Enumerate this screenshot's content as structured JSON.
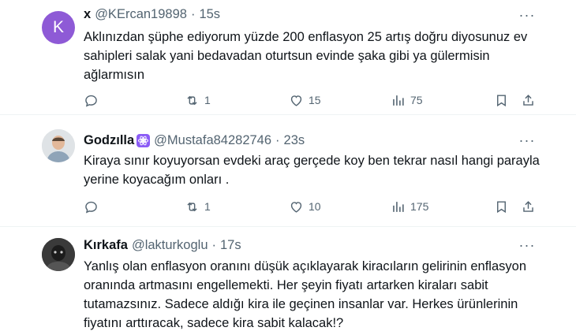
{
  "tweets": [
    {
      "avatar_letter": "K",
      "name": "x",
      "handle": "@KErcan19898",
      "dot": "·",
      "time": "15s",
      "text": "Aklınızdan şüphe ediyorum yüzde 200 enflasyon 25 artış doğru diyosunuz ev sahipleri salak yani bedavadan oturtsun evinde şaka gibi ya gülermisin ağlarmısın",
      "retweets": "1",
      "likes": "15",
      "views": "75",
      "avatar_color": "#8e5ad6"
    },
    {
      "name": "Godzılla",
      "handle": "@Mustafa84282746",
      "dot": "·",
      "time": "23s",
      "text": "Kiraya sınır koyuyorsan evdeki araç gerçede koy ben tekrar nasıl hangi parayla yerine koyacağım onları .",
      "retweets": "1",
      "likes": "10",
      "views": "175",
      "badge_icon": "atom-icon"
    },
    {
      "name": "Kırkafa",
      "handle": "@lakturkoglu",
      "dot": "·",
      "time": "17s",
      "text": "Yanlış olan enflasyon oranını düşük açıklayarak kiracıların gelirinin enflasyon oranında artmasını engellemekti. Her şeyin fiyatı artarken kiraları sabit tutamazsınız. Sadece aldığı kira ile geçinen insanlar var. Herkes ürünlerinin fiyatını arttıracak, sadece kira sabit kalacak!?"
    }
  ],
  "more_label": "···",
  "icons": {
    "reply": "reply-icon",
    "retweet": "retweet-icon",
    "like": "heart-icon",
    "views": "views-icon",
    "bookmark": "bookmark-icon",
    "share": "share-icon"
  },
  "colors": {
    "text": "#0f1419",
    "secondary": "#536471",
    "divider": "#eff3f4",
    "badge": "#8b5cf6"
  }
}
